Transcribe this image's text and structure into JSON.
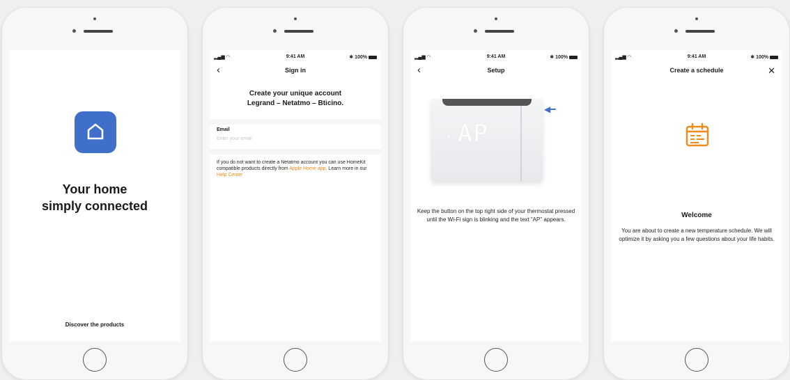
{
  "colors": {
    "brand_blue": "#3f6fc9",
    "accent_orange": "#f08a19"
  },
  "status_bar": {
    "time": "9:41 AM",
    "battery": "100%"
  },
  "screen1": {
    "icon": "home-icon",
    "heading_line1": "Your home",
    "heading_line2": "simply connected",
    "link": "Discover the products"
  },
  "screen2": {
    "nav_title": "Sign in",
    "heading_line1": "Create your unique account",
    "heading_line2": "Legrand – Netatmo – Bticino.",
    "email_label": "Email",
    "email_placeholder": "Enter your email",
    "info_text": "If you do not want to create a Netatmo account you can use HomeKit compatible products directly from ",
    "info_link1": "Apple Home app",
    "info_mid": ". Learn more in our ",
    "info_link2": "Help Center"
  },
  "screen3": {
    "nav_title": "Setup",
    "display_text": "AP",
    "instruction": "Keep the button on the top right side of your thermostat pressed until the Wi-Fi sign is blinking and the text \"AP\" appears."
  },
  "screen4": {
    "nav_title": "Create a schedule",
    "icon": "calendar-icon",
    "title": "Welcome",
    "text": "You are about to create a new temperature schedule. We will optimize it by asking you a few questions about your life habits."
  }
}
